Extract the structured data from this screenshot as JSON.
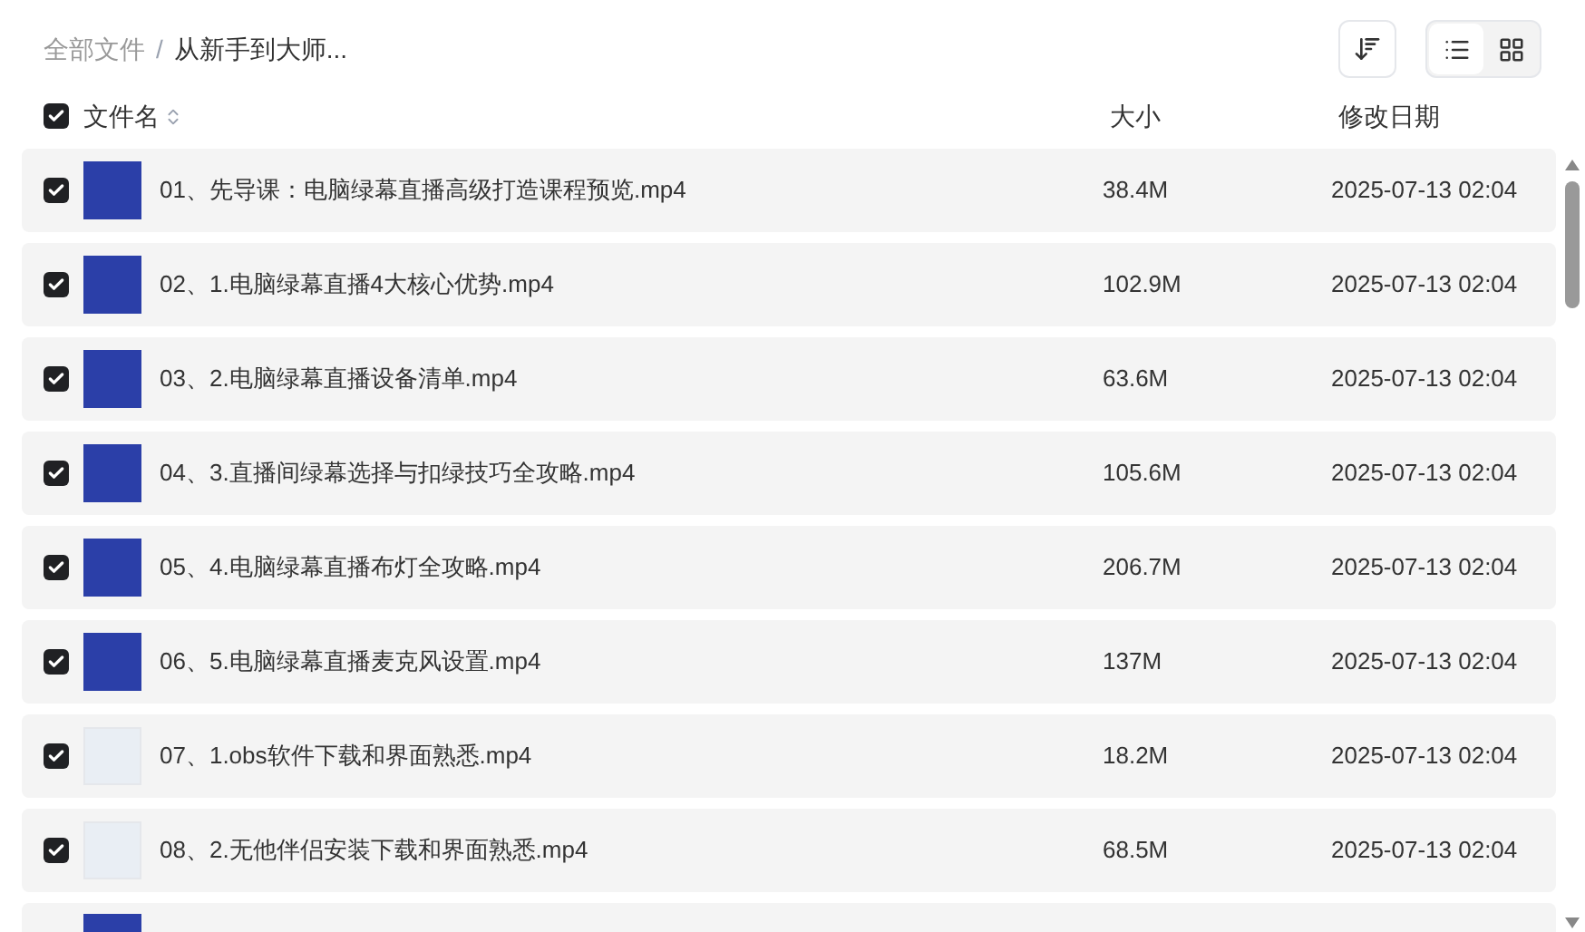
{
  "breadcrumb": [
    {
      "label": "全部文件",
      "current": false
    },
    {
      "label": "从新手到大师...",
      "current": true
    }
  ],
  "breadcrumb_separator": "/",
  "view_modes": [
    {
      "kind": "list",
      "selected": true
    },
    {
      "kind": "grid",
      "selected": false
    }
  ],
  "table": {
    "select_all_checked": true,
    "columns": [
      "文件名",
      "大小",
      "修改日期"
    ],
    "rows": [
      {
        "checked": true,
        "kind": "blue",
        "name": "01、先导课：电脑绿幕直播高级打造课程预览.mp4",
        "size": "38.4M",
        "modified": "2025-07-13 02:04"
      },
      {
        "checked": true,
        "kind": "blue",
        "name": "02、1.电脑绿幕直播4大核心优势.mp4",
        "size": "102.9M",
        "modified": "2025-07-13 02:04"
      },
      {
        "checked": true,
        "kind": "blue",
        "name": "03、2.电脑绿幕直播设备清单.mp4",
        "size": "63.6M",
        "modified": "2025-07-13 02:04"
      },
      {
        "checked": true,
        "kind": "blue",
        "name": "04、3.直播间绿幕选择与扣绿技巧全攻略.mp4",
        "size": "105.6M",
        "modified": "2025-07-13 02:04"
      },
      {
        "checked": true,
        "kind": "blue",
        "name": "05、4.电脑绿幕直播布灯全攻略.mp4",
        "size": "206.7M",
        "modified": "2025-07-13 02:04"
      },
      {
        "checked": true,
        "kind": "blue",
        "name": "06、5.电脑绿幕直播麦克风设置.mp4",
        "size": "137M",
        "modified": "2025-07-13 02:04"
      },
      {
        "checked": true,
        "kind": "light",
        "name": "07、1.obs软件下载和界面熟悉.mp4",
        "size": "18.2M",
        "modified": "2025-07-13 02:04"
      },
      {
        "checked": true,
        "kind": "light",
        "name": "08、2.无他伴侣安装下载和界面熟悉.mp4",
        "size": "68.5M",
        "modified": "2025-07-13 02:04"
      }
    ],
    "partial_row": {
      "kind": "blue"
    }
  }
}
